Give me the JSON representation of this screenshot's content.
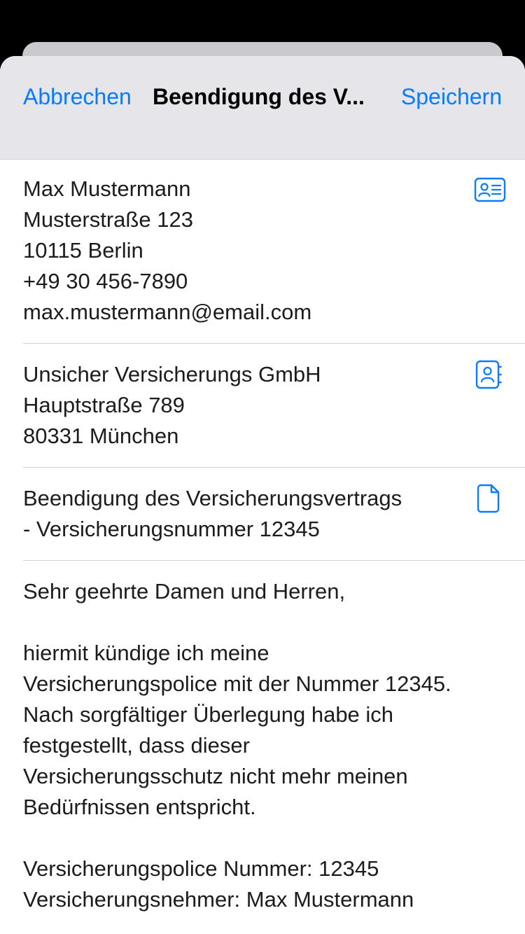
{
  "nav": {
    "cancel_label": "Abbrechen",
    "title": "Beendigung des V...",
    "save_label": "Speichern"
  },
  "sender": {
    "name": "Max Mustermann",
    "street": "Musterstraße 123",
    "city": "10115 Berlin",
    "phone": "+49 30 456-7890",
    "email": "max.mustermann@email.com",
    "icon": "contact-card-icon"
  },
  "recipient": {
    "company": "Unsicher Versicherungs GmbH",
    "street": "Hauptstraße 789",
    "city": "80331 München",
    "icon": "address-book-icon"
  },
  "subject": {
    "line1": "Beendigung des Versicherungsvertrags",
    "line2": "- Versicherungsnummer 12345",
    "icon": "document-icon"
  },
  "body": {
    "greeting": "Sehr geehrte Damen und Herren,",
    "p1_l1": "hiermit kündige ich meine",
    "p1_l2": "Versicherungspolice mit der Nummer 12345.",
    "p1_l3": "Nach sorgfältiger Überlegung habe ich",
    "p1_l4": "festgestellt, dass dieser",
    "p1_l5": "Versicherungsschutz nicht mehr meinen",
    "p1_l6": "Bedürfnissen entspricht.",
    "policy_line": "Versicherungspolice Nummer: 12345",
    "holder_line": "Versicherungsnehmer: Max Mustermann"
  },
  "colors": {
    "accent": "#0a7aff",
    "nav_background": "#e5e5ea",
    "separator": "#d1d1d6",
    "text": "#1c1c1e"
  }
}
